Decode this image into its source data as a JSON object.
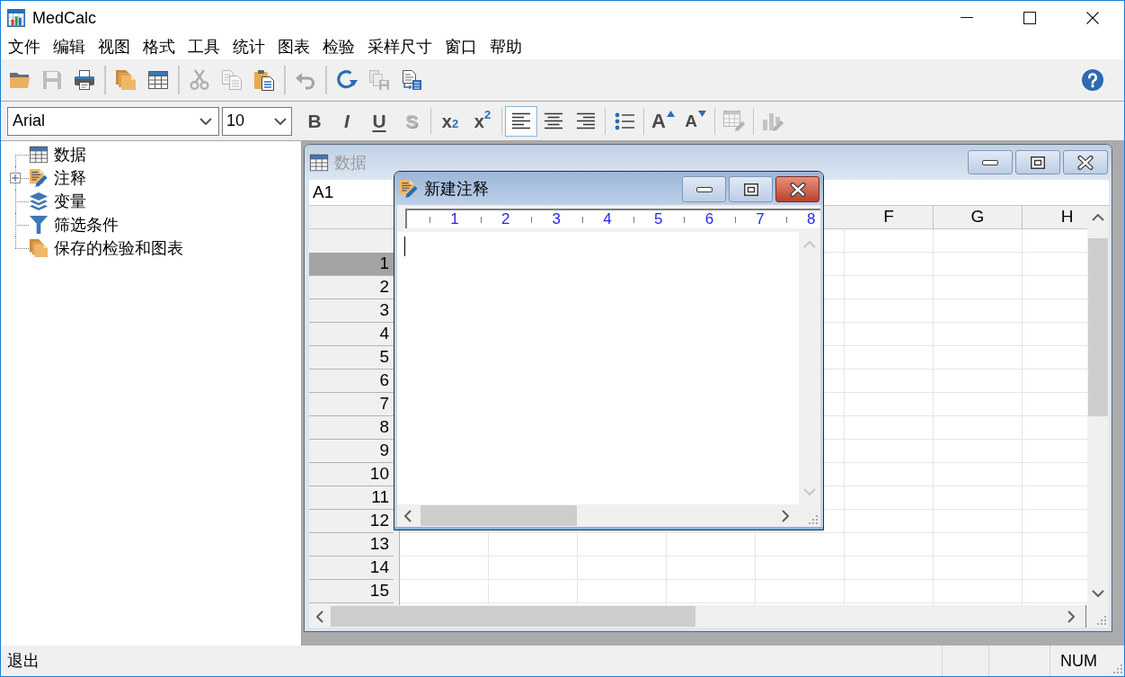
{
  "window": {
    "title": "MedCalc"
  },
  "menu": [
    "文件",
    "编辑",
    "视图",
    "格式",
    "工具",
    "统计",
    "图表",
    "检验",
    "采样尺寸",
    "窗口",
    "帮助"
  ],
  "toolbar": {
    "groups": [
      [
        {
          "kind": "open",
          "disabled": false
        },
        {
          "kind": "save",
          "disabled": true
        },
        {
          "kind": "print",
          "disabled": false
        }
      ],
      [
        {
          "kind": "documents",
          "disabled": false
        },
        {
          "kind": "table",
          "disabled": false
        }
      ],
      [
        {
          "kind": "cut",
          "disabled": true
        },
        {
          "kind": "copy",
          "disabled": true
        },
        {
          "kind": "paste",
          "disabled": false
        }
      ],
      [
        {
          "kind": "undo",
          "disabled": true
        }
      ],
      [
        {
          "kind": "refresh",
          "disabled": false
        },
        {
          "kind": "copy-output",
          "disabled": true
        },
        {
          "kind": "export",
          "disabled": false
        }
      ]
    ]
  },
  "format_toolbar": {
    "font": {
      "value": "Arial"
    },
    "size": {
      "value": "10"
    },
    "style_buttons": [
      {
        "kind": "bold",
        "label": "B",
        "disabled": false
      },
      {
        "kind": "italic",
        "label": "I",
        "disabled": false
      },
      {
        "kind": "underline",
        "label": "U",
        "disabled": false
      },
      {
        "kind": "shadow",
        "label": "S",
        "disabled": true
      }
    ],
    "script_buttons": [
      {
        "label": "x$_{2}$"
      },
      {
        "label": "x$^{2}$"
      }
    ],
    "align_buttons": [
      {
        "kind": "left",
        "selected": true
      },
      {
        "kind": "center",
        "selected": false
      },
      {
        "kind": "right",
        "selected": false
      }
    ],
    "size_buttons": [
      {
        "kind": "grow",
        "label": "A"
      },
      {
        "kind": "shrink",
        "label": "A"
      }
    ],
    "tool_buttons": [
      {
        "kind": "table-edit",
        "disabled": true
      },
      {
        "kind": "chart-edit",
        "disabled": true
      }
    ]
  },
  "tree": [
    {
      "kind": "data",
      "label": "数据"
    },
    {
      "kind": "notes",
      "label": "注释",
      "expanded": false
    },
    {
      "kind": "variables",
      "label": "变量"
    },
    {
      "kind": "filters",
      "label": "筛选条件"
    },
    {
      "kind": "saved",
      "label": "保存的检验和图表"
    }
  ],
  "data_window": {
    "title": "数据",
    "active": false,
    "cell_reference": "A1",
    "columns": [
      "F",
      "G",
      "H"
    ],
    "rows": [
      {
        "label": "1",
        "selected": true
      },
      {
        "label": "2",
        "selected": false
      },
      {
        "label": "3",
        "selected": false
      },
      {
        "label": "4",
        "selected": false
      },
      {
        "label": "5",
        "selected": false
      },
      {
        "label": "6",
        "selected": false
      },
      {
        "label": "7",
        "selected": false
      },
      {
        "label": "8",
        "selected": false
      },
      {
        "label": "9",
        "selected": false
      },
      {
        "label": "10",
        "selected": false
      },
      {
        "label": "11",
        "selected": false
      },
      {
        "label": "12",
        "selected": false
      },
      {
        "label": "13",
        "selected": false
      },
      {
        "label": "14",
        "selected": false
      },
      {
        "label": "15",
        "selected": false
      }
    ]
  },
  "note_window": {
    "title": "新建注释",
    "active": true,
    "ruler": [
      "1",
      "2",
      "3",
      "4",
      "5",
      "6",
      "7",
      "8"
    ]
  },
  "status_bar": {
    "text": "退出",
    "indicators": [
      "NUM"
    ]
  }
}
